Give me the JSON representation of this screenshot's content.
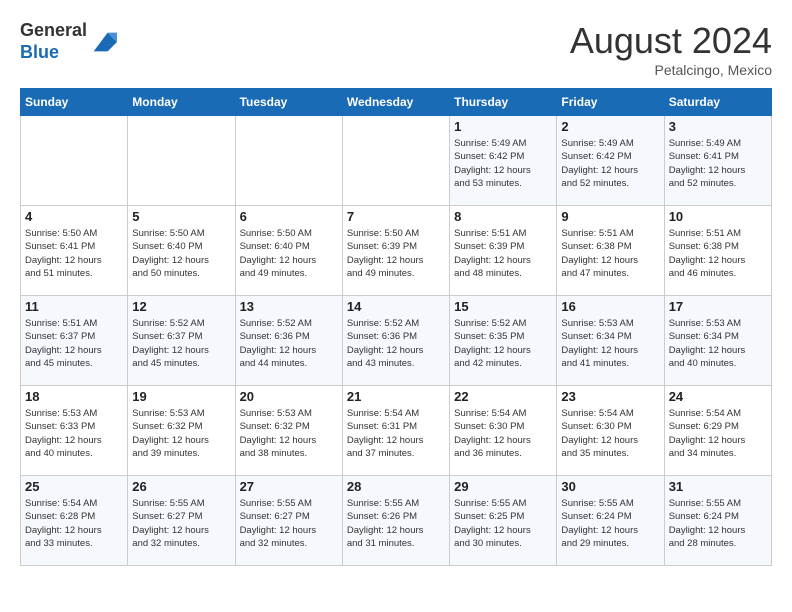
{
  "header": {
    "logo_line1": "General",
    "logo_line2": "Blue",
    "month": "August 2024",
    "location": "Petalcingo, Mexico"
  },
  "days_of_week": [
    "Sunday",
    "Monday",
    "Tuesday",
    "Wednesday",
    "Thursday",
    "Friday",
    "Saturday"
  ],
  "weeks": [
    [
      {
        "day": "",
        "info": ""
      },
      {
        "day": "",
        "info": ""
      },
      {
        "day": "",
        "info": ""
      },
      {
        "day": "",
        "info": ""
      },
      {
        "day": "1",
        "info": "Sunrise: 5:49 AM\nSunset: 6:42 PM\nDaylight: 12 hours\nand 53 minutes."
      },
      {
        "day": "2",
        "info": "Sunrise: 5:49 AM\nSunset: 6:42 PM\nDaylight: 12 hours\nand 52 minutes."
      },
      {
        "day": "3",
        "info": "Sunrise: 5:49 AM\nSunset: 6:41 PM\nDaylight: 12 hours\nand 52 minutes."
      }
    ],
    [
      {
        "day": "4",
        "info": "Sunrise: 5:50 AM\nSunset: 6:41 PM\nDaylight: 12 hours\nand 51 minutes."
      },
      {
        "day": "5",
        "info": "Sunrise: 5:50 AM\nSunset: 6:40 PM\nDaylight: 12 hours\nand 50 minutes."
      },
      {
        "day": "6",
        "info": "Sunrise: 5:50 AM\nSunset: 6:40 PM\nDaylight: 12 hours\nand 49 minutes."
      },
      {
        "day": "7",
        "info": "Sunrise: 5:50 AM\nSunset: 6:39 PM\nDaylight: 12 hours\nand 49 minutes."
      },
      {
        "day": "8",
        "info": "Sunrise: 5:51 AM\nSunset: 6:39 PM\nDaylight: 12 hours\nand 48 minutes."
      },
      {
        "day": "9",
        "info": "Sunrise: 5:51 AM\nSunset: 6:38 PM\nDaylight: 12 hours\nand 47 minutes."
      },
      {
        "day": "10",
        "info": "Sunrise: 5:51 AM\nSunset: 6:38 PM\nDaylight: 12 hours\nand 46 minutes."
      }
    ],
    [
      {
        "day": "11",
        "info": "Sunrise: 5:51 AM\nSunset: 6:37 PM\nDaylight: 12 hours\nand 45 minutes."
      },
      {
        "day": "12",
        "info": "Sunrise: 5:52 AM\nSunset: 6:37 PM\nDaylight: 12 hours\nand 45 minutes."
      },
      {
        "day": "13",
        "info": "Sunrise: 5:52 AM\nSunset: 6:36 PM\nDaylight: 12 hours\nand 44 minutes."
      },
      {
        "day": "14",
        "info": "Sunrise: 5:52 AM\nSunset: 6:36 PM\nDaylight: 12 hours\nand 43 minutes."
      },
      {
        "day": "15",
        "info": "Sunrise: 5:52 AM\nSunset: 6:35 PM\nDaylight: 12 hours\nand 42 minutes."
      },
      {
        "day": "16",
        "info": "Sunrise: 5:53 AM\nSunset: 6:34 PM\nDaylight: 12 hours\nand 41 minutes."
      },
      {
        "day": "17",
        "info": "Sunrise: 5:53 AM\nSunset: 6:34 PM\nDaylight: 12 hours\nand 40 minutes."
      }
    ],
    [
      {
        "day": "18",
        "info": "Sunrise: 5:53 AM\nSunset: 6:33 PM\nDaylight: 12 hours\nand 40 minutes."
      },
      {
        "day": "19",
        "info": "Sunrise: 5:53 AM\nSunset: 6:32 PM\nDaylight: 12 hours\nand 39 minutes."
      },
      {
        "day": "20",
        "info": "Sunrise: 5:53 AM\nSunset: 6:32 PM\nDaylight: 12 hours\nand 38 minutes."
      },
      {
        "day": "21",
        "info": "Sunrise: 5:54 AM\nSunset: 6:31 PM\nDaylight: 12 hours\nand 37 minutes."
      },
      {
        "day": "22",
        "info": "Sunrise: 5:54 AM\nSunset: 6:30 PM\nDaylight: 12 hours\nand 36 minutes."
      },
      {
        "day": "23",
        "info": "Sunrise: 5:54 AM\nSunset: 6:30 PM\nDaylight: 12 hours\nand 35 minutes."
      },
      {
        "day": "24",
        "info": "Sunrise: 5:54 AM\nSunset: 6:29 PM\nDaylight: 12 hours\nand 34 minutes."
      }
    ],
    [
      {
        "day": "25",
        "info": "Sunrise: 5:54 AM\nSunset: 6:28 PM\nDaylight: 12 hours\nand 33 minutes."
      },
      {
        "day": "26",
        "info": "Sunrise: 5:55 AM\nSunset: 6:27 PM\nDaylight: 12 hours\nand 32 minutes."
      },
      {
        "day": "27",
        "info": "Sunrise: 5:55 AM\nSunset: 6:27 PM\nDaylight: 12 hours\nand 32 minutes."
      },
      {
        "day": "28",
        "info": "Sunrise: 5:55 AM\nSunset: 6:26 PM\nDaylight: 12 hours\nand 31 minutes."
      },
      {
        "day": "29",
        "info": "Sunrise: 5:55 AM\nSunset: 6:25 PM\nDaylight: 12 hours\nand 30 minutes."
      },
      {
        "day": "30",
        "info": "Sunrise: 5:55 AM\nSunset: 6:24 PM\nDaylight: 12 hours\nand 29 minutes."
      },
      {
        "day": "31",
        "info": "Sunrise: 5:55 AM\nSunset: 6:24 PM\nDaylight: 12 hours\nand 28 minutes."
      }
    ]
  ]
}
